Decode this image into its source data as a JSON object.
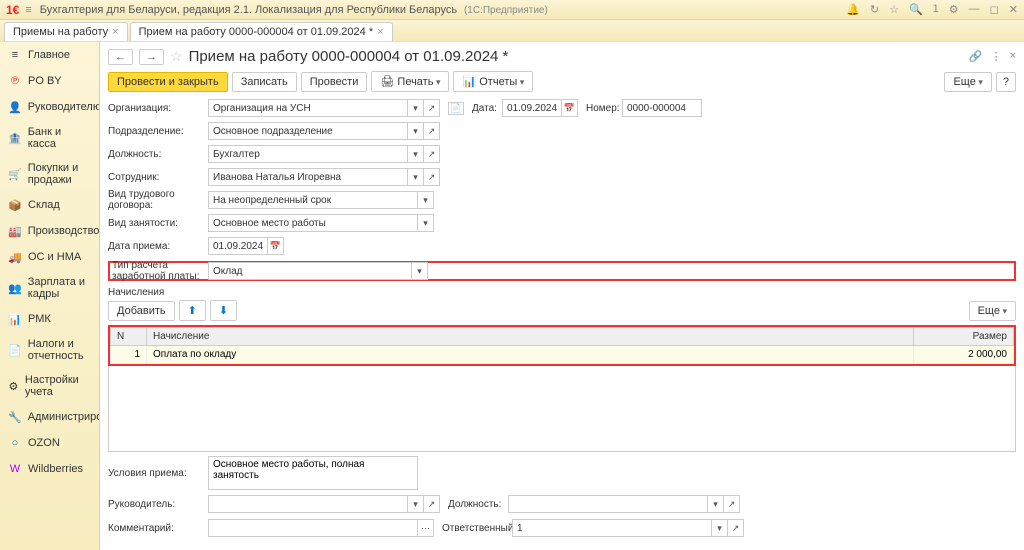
{
  "titlebar": {
    "logo": "1€",
    "title": "Бухгалтерия для Беларуси, редакция 2.1. Локализация для Республики Беларусь",
    "app_suffix": "(1С:Предприятие)"
  },
  "tabs": [
    {
      "label": "Приемы на работу",
      "closable": true
    },
    {
      "label": "Прием на работу 0000-000004 от 01.09.2024 *",
      "closable": true
    }
  ],
  "sidebar": {
    "items": [
      {
        "icon": "≡",
        "label": "Главное",
        "name": "sidebar-item-main"
      },
      {
        "icon": "℗",
        "label": "PO BY",
        "name": "sidebar-item-poby",
        "color": "#d33"
      },
      {
        "icon": "👤",
        "label": "Руководителю",
        "name": "sidebar-item-manager"
      },
      {
        "icon": "🏦",
        "label": "Банк и касса",
        "name": "sidebar-item-bank"
      },
      {
        "icon": "🛒",
        "label": "Покупки и продажи",
        "name": "sidebar-item-trade"
      },
      {
        "icon": "📦",
        "label": "Склад",
        "name": "sidebar-item-warehouse"
      },
      {
        "icon": "🏭",
        "label": "Производство",
        "name": "sidebar-item-production"
      },
      {
        "icon": "🚚",
        "label": "ОС и НМА",
        "name": "sidebar-item-assets"
      },
      {
        "icon": "👥",
        "label": "Зарплата и кадры",
        "name": "sidebar-item-hr"
      },
      {
        "icon": "📊",
        "label": "РМК",
        "name": "sidebar-item-rmk"
      },
      {
        "icon": "📄",
        "label": "Налоги и отчетность",
        "name": "sidebar-item-tax"
      },
      {
        "icon": "⚙",
        "label": "Настройки учета",
        "name": "sidebar-item-settings"
      },
      {
        "icon": "🔧",
        "label": "Администрирование",
        "name": "sidebar-item-admin"
      },
      {
        "icon": "○",
        "label": "OZON",
        "name": "sidebar-item-ozon",
        "color": "#06c"
      },
      {
        "icon": "W",
        "label": "Wildberries",
        "name": "sidebar-item-wb",
        "color": "#a0f"
      }
    ]
  },
  "document": {
    "title": "Прием на работу 0000-000004 от 01.09.2024 *"
  },
  "toolbar": {
    "post_close": "Провести и закрыть",
    "save": "Записать",
    "post": "Провести",
    "print": "Печать",
    "print_icon": "🖨",
    "reports": "Отчеты",
    "reports_icon": "📊",
    "more": "Еще",
    "help": "?"
  },
  "form": {
    "org_label": "Организация:",
    "org_value": "Организация на УСН",
    "date_label": "Дата:",
    "date_value": "01.09.2024",
    "num_label": "Номер:",
    "num_value": "0000-000004",
    "dept_label": "Подразделение:",
    "dept_value": "Основное подразделение",
    "position_label": "Должность:",
    "position_value": "Бухгалтер",
    "employee_label": "Сотрудник:",
    "employee_value": "Иванова Наталья Игоревна",
    "contract_type_label": "Вид трудового договора:",
    "contract_type_value": "На неопределенный срок",
    "employment_label": "Вид занятости:",
    "employment_value": "Основное место работы",
    "hire_date_label": "Дата приема:",
    "hire_date_value": "01.09.2024",
    "salary_type_label": "Тип расчета заработной платы:",
    "salary_type_value": "Оклад"
  },
  "accruals": {
    "section": "Начисления",
    "add": "Добавить",
    "more": "Еще",
    "col_n": "N",
    "col_accrual": "Начисление",
    "col_amount": "Размер",
    "rows": [
      {
        "n": "1",
        "name": "Оплата по окладу",
        "amount": "2 000,00"
      }
    ]
  },
  "footer": {
    "conditions_label": "Условия приема:",
    "conditions_value": "Основное место работы, полная занятость",
    "manager_label": "Руководитель:",
    "manager_value": "",
    "position2_label": "Должность:",
    "position2_value": "",
    "comment_label": "Комментарий:",
    "comment_value": "",
    "responsible_label": "Ответственный:",
    "responsible_value": "1"
  }
}
